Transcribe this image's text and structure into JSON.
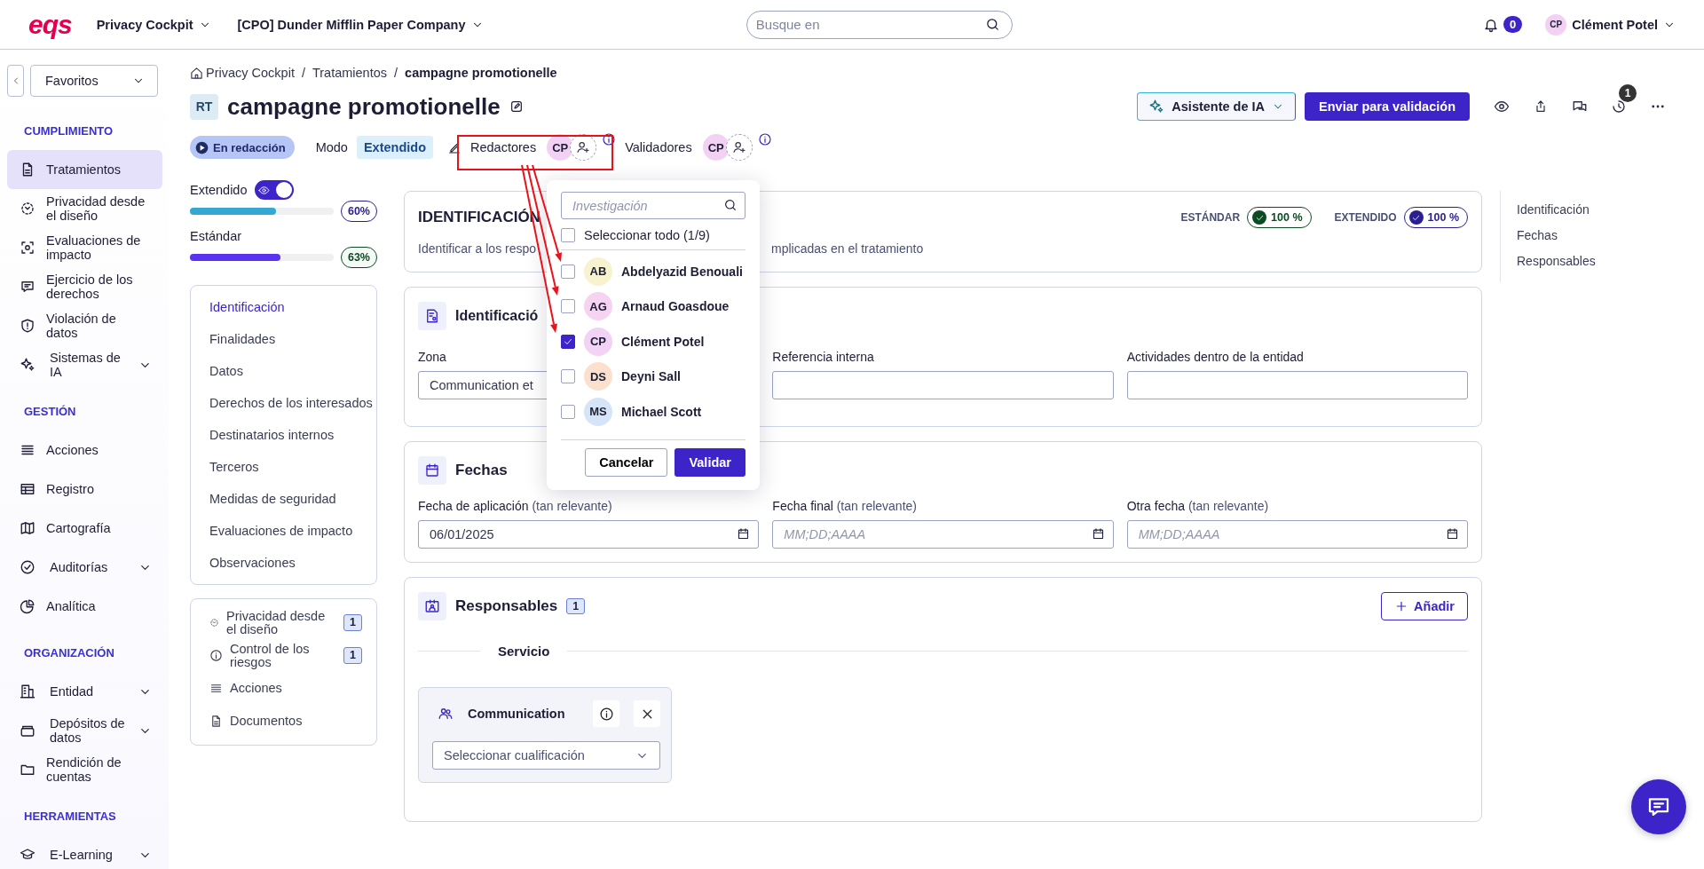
{
  "top_bar": {
    "logo": "eqs",
    "modules": [
      {
        "label": "Privacy Cockpit"
      },
      {
        "label": "[CPO] Dunder Mifflin Paper Company"
      }
    ],
    "search": {
      "placeholder": "Busque en"
    },
    "notifications": {
      "count": "0"
    },
    "user": {
      "initials": "CP",
      "name": "Clément Potel"
    }
  },
  "sidebar": {
    "favorites": {
      "label": "Favoritos"
    },
    "sections": [
      {
        "title": "CUMPLIMIENTO",
        "items": [
          {
            "label": "Tratamientos",
            "kind": "link",
            "selected": true
          },
          {
            "label": "Privacidad desde el diseño",
            "kind": "link",
            "selected": false
          },
          {
            "label": "Evaluaciones de impacto",
            "kind": "link",
            "selected": false
          },
          {
            "label": "Ejercicio de los derechos",
            "kind": "link",
            "selected": false
          },
          {
            "label": "Violación de datos",
            "kind": "link",
            "selected": false
          },
          {
            "label": "Sistemas de IA",
            "kind": "group",
            "selected": false
          }
        ]
      },
      {
        "title": "GESTIÓN",
        "items": [
          {
            "label": "Acciones",
            "kind": "link",
            "selected": false
          },
          {
            "label": "Registro",
            "kind": "link",
            "selected": false
          },
          {
            "label": "Cartografía",
            "kind": "link",
            "selected": false
          },
          {
            "label": "Auditorías",
            "kind": "group",
            "selected": false
          },
          {
            "label": "Analítica",
            "kind": "link",
            "selected": false
          }
        ]
      },
      {
        "title": "ORGANIZACIÓN",
        "items": [
          {
            "label": "Entidad",
            "kind": "group",
            "selected": false
          },
          {
            "label": "Depósitos de datos",
            "kind": "group",
            "selected": false
          },
          {
            "label": "Rendición de cuentas",
            "kind": "link",
            "selected": false
          }
        ]
      },
      {
        "title": "HERRAMIENTAS",
        "items": [
          {
            "label": "E-Learning",
            "kind": "group",
            "selected": false
          }
        ]
      }
    ]
  },
  "header": {
    "breadcrumb": {
      "separator": "/",
      "items": [
        "Privacy Cockpit",
        "Tratamientos",
        "campagne promotionelle"
      ]
    },
    "badge": "RT",
    "title": "campagne promotionelle",
    "ai_button": "Asistente de IA",
    "submit_button": "Enviar para validación",
    "history_count": "1",
    "status": "En redacción",
    "mode_label": "Modo",
    "mode_value": "Extendido",
    "editors": {
      "label": "Redactores",
      "initials": "CP"
    },
    "validators": {
      "label": "Validadores",
      "initials": "CP"
    }
  },
  "progress": {
    "extended": {
      "label": "Extendido",
      "toggle_on": true,
      "level": 0.6,
      "reading": "60%"
    },
    "standard": {
      "label": "Estándar",
      "level": 0.63,
      "reading": "63%"
    }
  },
  "section_nav": [
    {
      "label": "Identificación",
      "selected": true
    },
    {
      "label": "Finalidades",
      "selected": false
    },
    {
      "label": "Datos",
      "selected": false
    },
    {
      "label": "Derechos de los interesados",
      "selected": false
    },
    {
      "label": "Destinatarios internos",
      "selected": false
    },
    {
      "label": "Terceros",
      "selected": false
    },
    {
      "label": "Medidas de seguridad",
      "selected": false
    },
    {
      "label": "Evaluaciones de impacto",
      "selected": false
    },
    {
      "label": "Observaciones",
      "selected": false
    }
  ],
  "related": [
    {
      "label": "Privacidad desde el diseño",
      "count": "1"
    },
    {
      "label": "Control de los riesgos",
      "count": "1"
    },
    {
      "label": "Acciones"
    },
    {
      "label": "Documentos"
    }
  ],
  "intro": {
    "title": "IDENTIFICACIÓN",
    "description_start": "Identificar a los respo",
    "description_end": "mplicadas en el tratamiento",
    "scores": [
      {
        "label": "ESTÁNDAR",
        "value": "100 %",
        "color": "#0c4a23"
      },
      {
        "label": "EXTENDIDO",
        "value": "100 %",
        "color": "#2a1f8f"
      }
    ]
  },
  "identification": {
    "title": "Identificació",
    "fields": [
      {
        "label": "Zona",
        "value": "Communication et"
      },
      {
        "label": "Referencia interna"
      },
      {
        "label": "Actividades dentro de la entidad"
      }
    ]
  },
  "dates": {
    "title": "Fechas",
    "fields": [
      {
        "label": "Fecha de aplicación",
        "hint": "(tan relevante)",
        "value": "06/01/2025"
      },
      {
        "label": "Fecha final",
        "hint": "(tan relevante)",
        "placeholder": "MM;DD;AAAA"
      },
      {
        "label": "Otra fecha",
        "hint": "(tan relevante)",
        "placeholder": "MM;DD;AAAA"
      }
    ]
  },
  "owners": {
    "title": "Responsables",
    "count": "1",
    "add_button": "Añadir",
    "group": "Servicio",
    "entity": "Communication",
    "qualification_placeholder": "Seleccionar cualificación"
  },
  "toc": [
    "Identificación",
    "Fechas",
    "Responsables"
  ],
  "popup": {
    "search_placeholder": "Investigación",
    "select_all": {
      "label": "Seleccionar todo (1/9)",
      "checked": false
    },
    "people": [
      {
        "initials": "AB",
        "name": "Abdelyazid Benouali",
        "checked": false,
        "color": "#f8f3cf"
      },
      {
        "initials": "AG",
        "name": "Arnaud Goasdoue",
        "checked": false,
        "color": "#f6d3f1"
      },
      {
        "initials": "CP",
        "name": "Clément Potel",
        "checked": true,
        "color": "#f2d2f5"
      },
      {
        "initials": "DS",
        "name": "Deyni Sall",
        "checked": false,
        "color": "#fbe1cd"
      },
      {
        "initials": "MS",
        "name": "Michael Scott",
        "checked": false,
        "color": "#d5e4f7"
      }
    ],
    "cancel": "Cancelar",
    "confirm": "Validar"
  }
}
